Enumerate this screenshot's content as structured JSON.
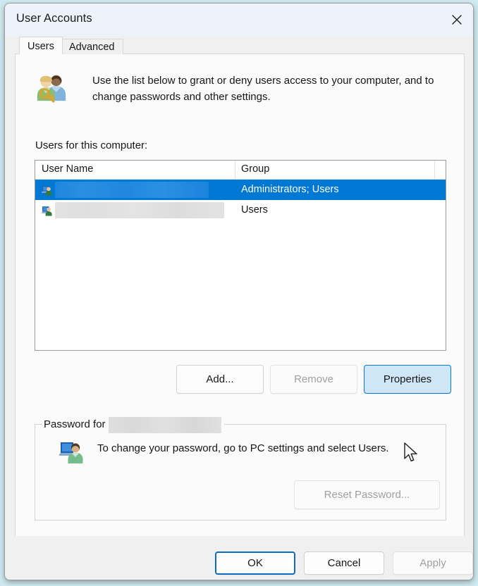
{
  "window": {
    "title": "User Accounts",
    "close_icon": "close-icon"
  },
  "tabs": [
    {
      "label": "Users",
      "active": true
    },
    {
      "label": "Advanced",
      "active": false
    }
  ],
  "intro": {
    "icon": "users-group-icon",
    "text": "Use the list below to grant or deny users access to your computer, and to change passwords and other settings."
  },
  "list": {
    "label": "Users for this computer:",
    "columns": [
      "User Name",
      "Group"
    ],
    "rows": [
      {
        "icon": "user-account-icon",
        "user_name": "",
        "user_name_redacted": true,
        "group": "Administrators; Users",
        "selected": true
      },
      {
        "icon": "user-account-icon",
        "user_name": "",
        "user_name_redacted": true,
        "group": "Users",
        "selected": false
      }
    ]
  },
  "actions": {
    "add": {
      "label": "Add...",
      "state": "enabled"
    },
    "remove": {
      "label": "Remove",
      "state": "disabled"
    },
    "properties": {
      "label": "Properties",
      "state": "hovered"
    }
  },
  "password_group": {
    "legend_prefix": "Password for",
    "legend_user_redacted": true,
    "icon": "user-monitor-icon",
    "text": "To change your password, go to PC settings and select Users.",
    "reset_button": {
      "label": "Reset Password...",
      "state": "disabled"
    }
  },
  "footer": {
    "ok": {
      "label": "OK",
      "state": "default"
    },
    "cancel": {
      "label": "Cancel",
      "state": "enabled"
    },
    "apply": {
      "label": "Apply",
      "state": "disabled"
    }
  },
  "colors": {
    "selection_blue": "#0078d4",
    "accent_border": "#0a6cc4",
    "hover_fill": "#cfe6f7",
    "window_bg": "#f0f0f0",
    "panel_bg": "#fbfbfb",
    "titlebar_bg": "#eef2fa",
    "disabled_text": "#a0a0a0"
  }
}
